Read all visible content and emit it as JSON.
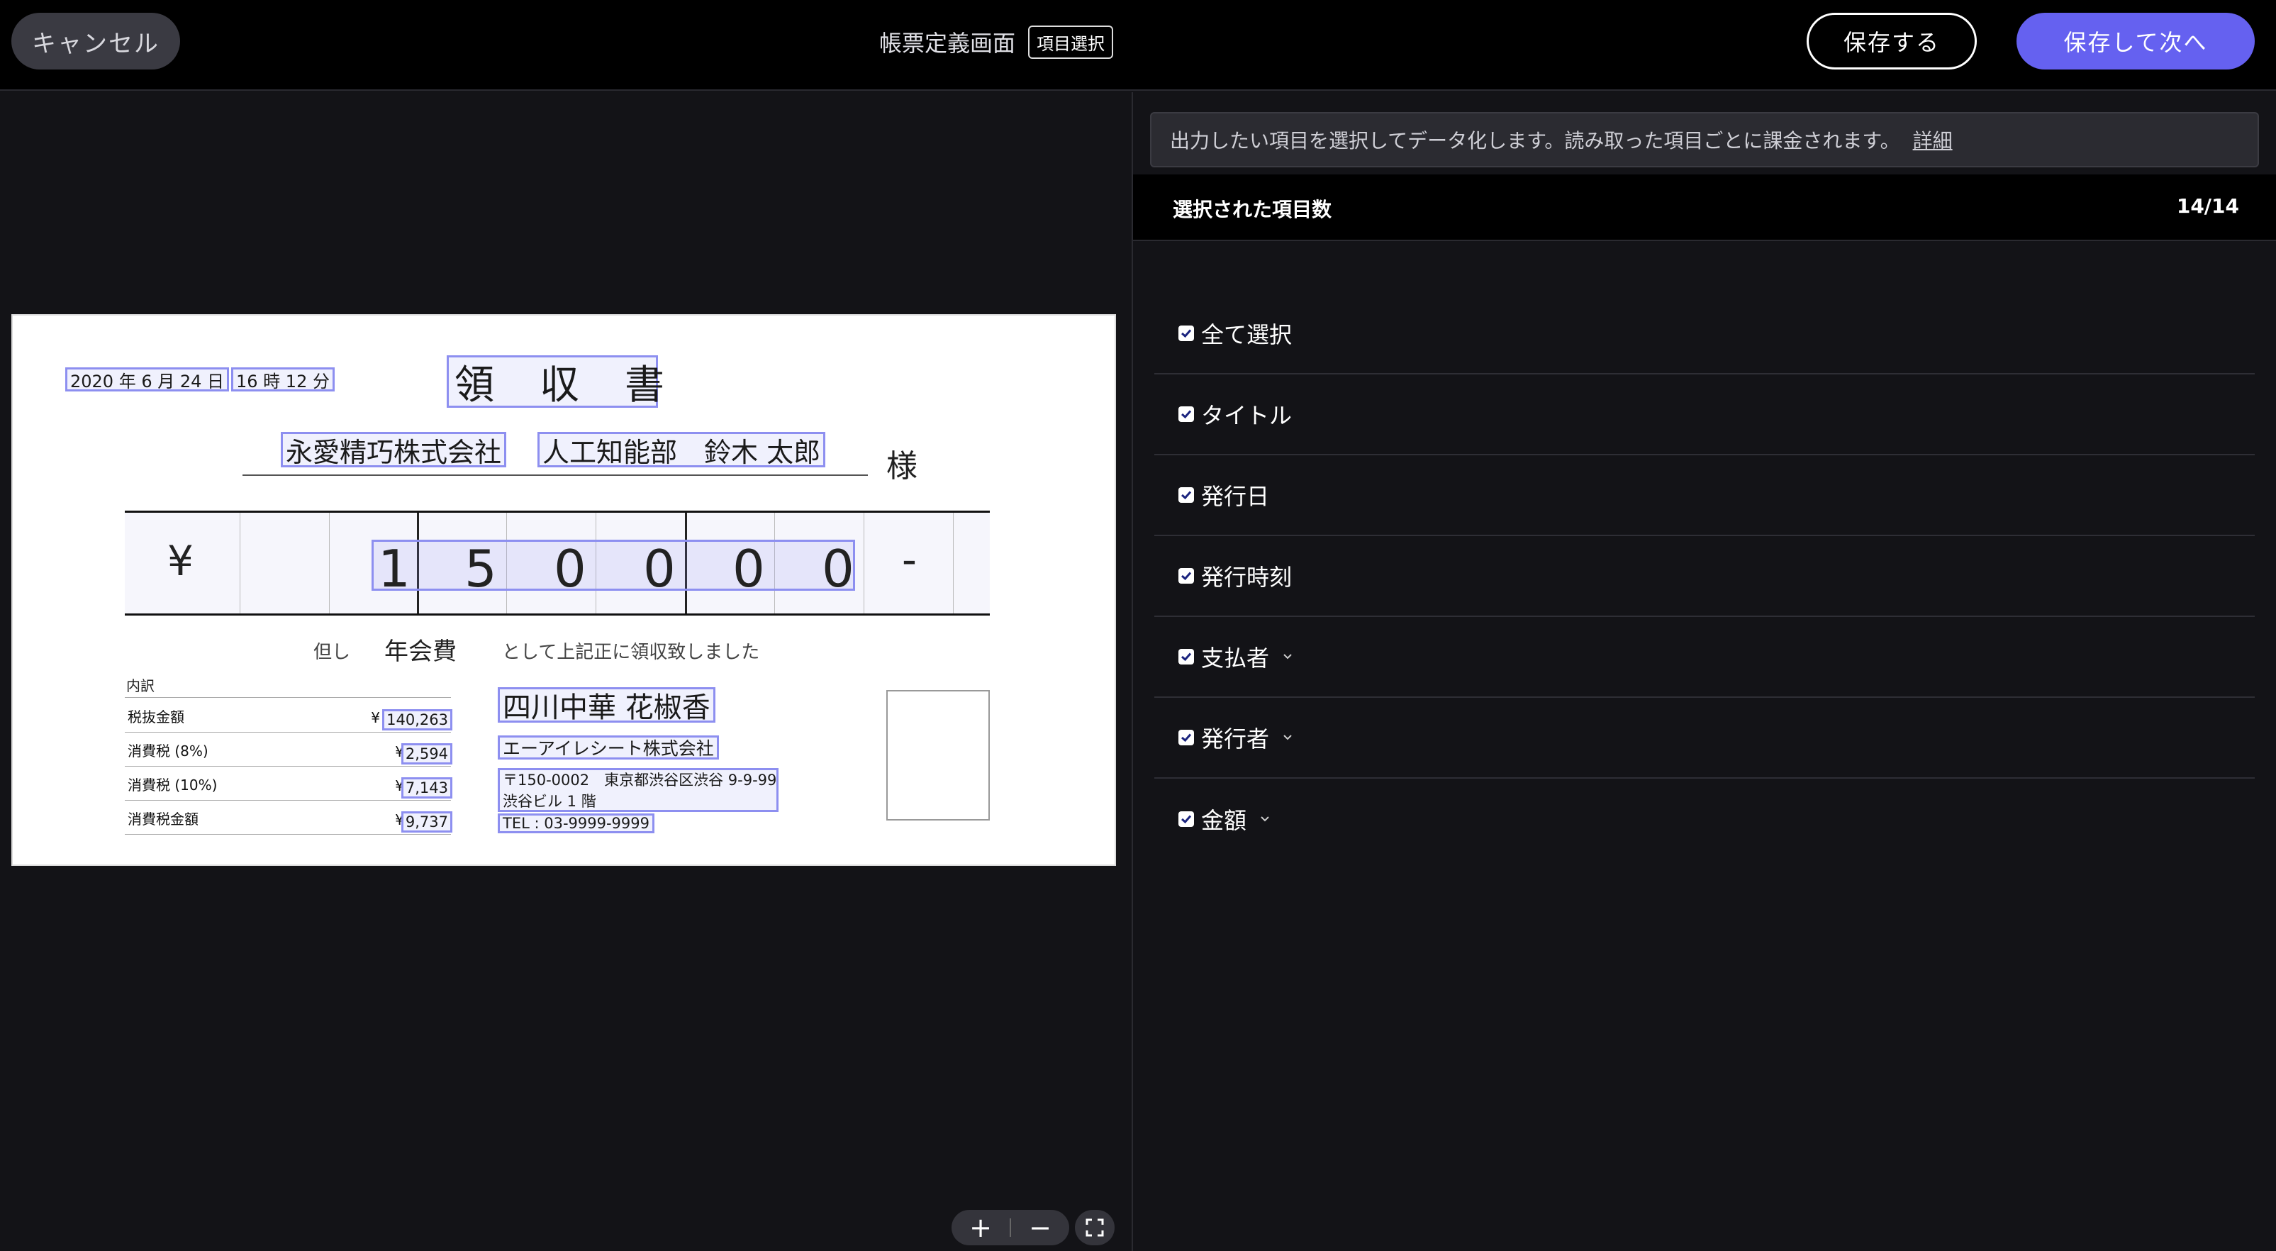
{
  "header": {
    "cancel_label": "キャンセル",
    "page_title": "帳票定義画面",
    "mode_badge": "項目選択",
    "save_label": "保存する",
    "save_next_label": "保存して次へ"
  },
  "document": {
    "date": "2020 年 6 月 24 日",
    "time": "16 時 12 分",
    "title": "領　収　書",
    "payee_company": "永愛精巧株式会社",
    "payee_person": "人工知能部　鈴木 太郎",
    "honorific": "様",
    "yen_mark": "¥",
    "digits": [
      "1",
      "5",
      "0",
      "0",
      "0",
      "0"
    ],
    "dash": "-",
    "tadashi": "但し",
    "purpose": "年会費",
    "received_text": "として上記正に領収致しました",
    "breakdown_title": "内訳",
    "breakdown": [
      {
        "label": "税抜金額",
        "yen": "¥",
        "value": "140,263"
      },
      {
        "label": "消費税 (8%)",
        "yen": "¥",
        "value": "2,594"
      },
      {
        "label": "消費税 (10%)",
        "yen": "¥",
        "value": "7,143"
      },
      {
        "label": "消費税金額",
        "yen": "¥",
        "value": "9,737"
      }
    ],
    "issuer_name": "四川中華 花椒香",
    "issuer_company": "エーアイレシート株式会社",
    "issuer_address_1": "〒150-0002　東京都渋谷区渋谷 9-9-99",
    "issuer_address_2": "渋谷ビル 1 階",
    "issuer_tel": "TEL : 03-9999-9999"
  },
  "zoom": {
    "in": "+",
    "out": "−"
  },
  "panel": {
    "info_text": "出力したい項目を選択してデータ化します。読み取った項目ごとに課金されます。",
    "info_link": "詳細",
    "count_label": "選択された項目数",
    "count_value": "14/14",
    "items": [
      {
        "label": "全て選択",
        "checked": true,
        "expandable": false
      },
      {
        "label": "タイトル",
        "checked": true,
        "expandable": false
      },
      {
        "label": "発行日",
        "checked": true,
        "expandable": false
      },
      {
        "label": "発行時刻",
        "checked": true,
        "expandable": false
      },
      {
        "label": "支払者",
        "checked": true,
        "expandable": true
      },
      {
        "label": "発行者",
        "checked": true,
        "expandable": true
      },
      {
        "label": "金額",
        "checked": true,
        "expandable": true
      }
    ]
  },
  "colors": {
    "accent": "#6561f0",
    "highlight": "#8d8ff0"
  }
}
